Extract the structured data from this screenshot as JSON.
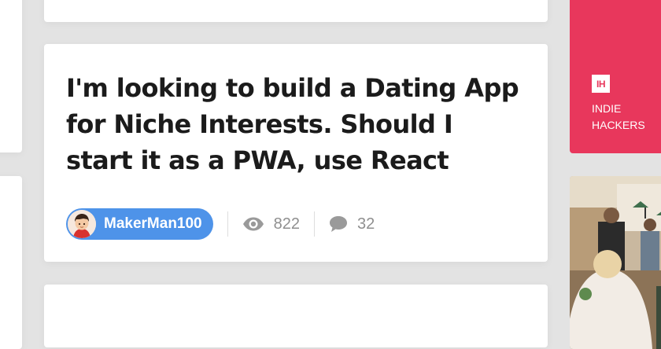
{
  "post": {
    "title": "I'm looking to build a Dating App for Niche Interests. Should I start it as a PWA, use React",
    "author": "MakerMan100",
    "views": "822",
    "comments": "32"
  },
  "sidebar_ad": {
    "logo_text": "IH",
    "line1": "INDIE",
    "line2": "HACKERS",
    "accent_color": "#e8375c"
  },
  "icons": {
    "views": "eye-icon",
    "comments": "comment-icon",
    "avatar": "avatar"
  },
  "colors": {
    "author_pill": "#4e93e9",
    "background": "#e3e3e3",
    "card": "#ffffff"
  }
}
